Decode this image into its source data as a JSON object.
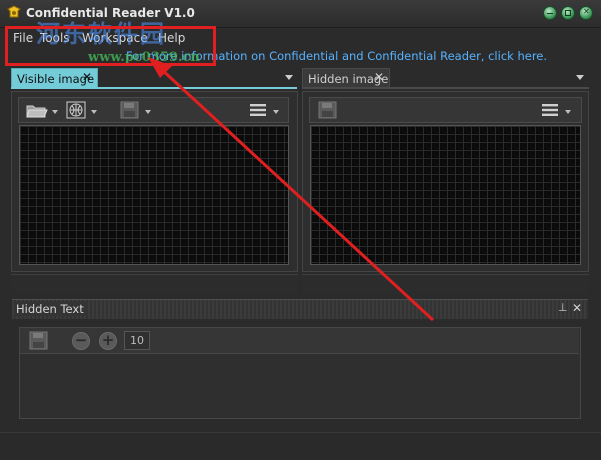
{
  "window": {
    "title": "Confidential Reader V1.0",
    "controls": [
      "minimize",
      "maximize",
      "close"
    ]
  },
  "menu": {
    "items": [
      "File",
      "Tools",
      "Workspace",
      "Help"
    ]
  },
  "info_link": "For more information on Confidential and Confidential Reader, click here.",
  "tabs": {
    "visible": {
      "label": "Visible image",
      "close": "✕"
    },
    "hidden": {
      "label": "Hidden image",
      "close": "✕"
    }
  },
  "hidden_text": {
    "title": "Hidden Text",
    "font_size_value": "10",
    "pin": "⊥",
    "close": "✕"
  },
  "watermark": {
    "chinese": "河东软件园",
    "url": "www.pc0359.cn"
  },
  "colors": {
    "accent_tab": "#74ccd8",
    "link": "#58b2ff",
    "annotation": "#e02020",
    "window_button": "#3f9a5b"
  },
  "icons": [
    "app-icon",
    "open-folder-icon",
    "globe-icon",
    "save-icon",
    "hamburger-menu-icon",
    "minus-icon",
    "plus-icon",
    "pin-icon",
    "close-icon"
  ]
}
